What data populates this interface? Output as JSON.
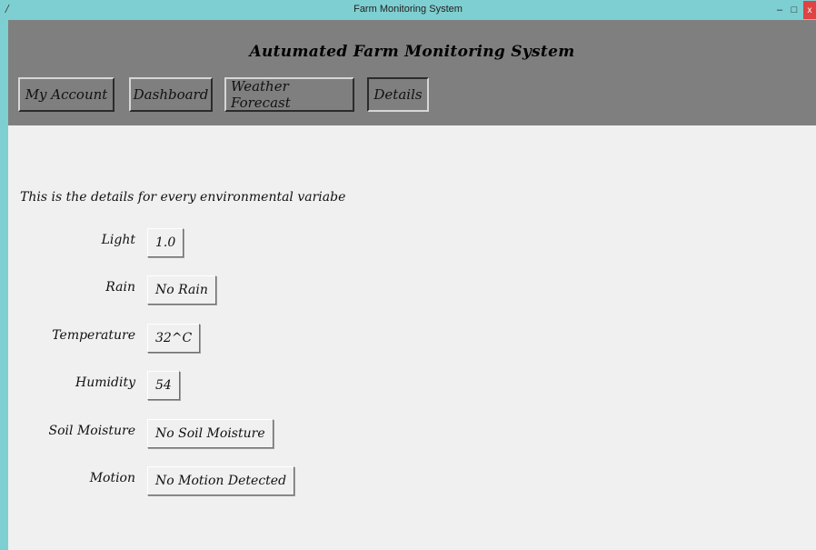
{
  "window": {
    "title": "Farm Monitoring System",
    "minimize": "–",
    "maximize": "□",
    "close": "x"
  },
  "header": {
    "title": "Autumated Farm Monitoring System"
  },
  "nav": {
    "account": "My Account",
    "dashboard": "Dashboard",
    "weather": "Weather Forecast",
    "details": "Details"
  },
  "details": {
    "intro": "This is the details for every environmental variabe",
    "light_label": "Light",
    "light_value": "1.0",
    "rain_label": "Rain",
    "rain_value": "No Rain",
    "temperature_label": "Temperature",
    "temperature_value": "32^C",
    "humidity_label": "Humidity",
    "humidity_value": "54",
    "soil_label": "Soil Moisture",
    "soil_value": "No Soil Moisture",
    "motion_label": "Motion",
    "motion_value": "No Motion Detected"
  }
}
